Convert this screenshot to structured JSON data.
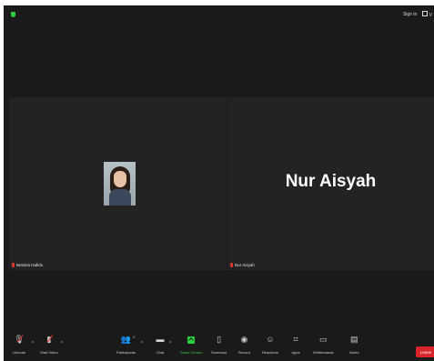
{
  "topbar": {
    "signin": "Sign in",
    "view": "V"
  },
  "participants": [
    {
      "name": "Betsina Hafidu",
      "muted": true,
      "has_photo": true
    },
    {
      "name": "Nur Aisyah",
      "muted": true,
      "display_name_big": "Nur Aisyah"
    }
  ],
  "toolbar": {
    "unmute": "Unmute",
    "start_video": "Start Video",
    "participants": "Participants",
    "participants_count": "2",
    "chat": "Chat",
    "share_screen": "Share Screen",
    "summary": "Summary",
    "record": "Record",
    "reactions": "Reactions",
    "apps": "Apps",
    "whiteboards": "Whiteboards",
    "notes": "Notes",
    "leave": "Leave"
  },
  "colors": {
    "bg": "#1a1a1a",
    "tile": "#232323",
    "accent_green": "#2ecc40",
    "leave_red": "#d9252a",
    "muted_red": "#e0322d"
  }
}
